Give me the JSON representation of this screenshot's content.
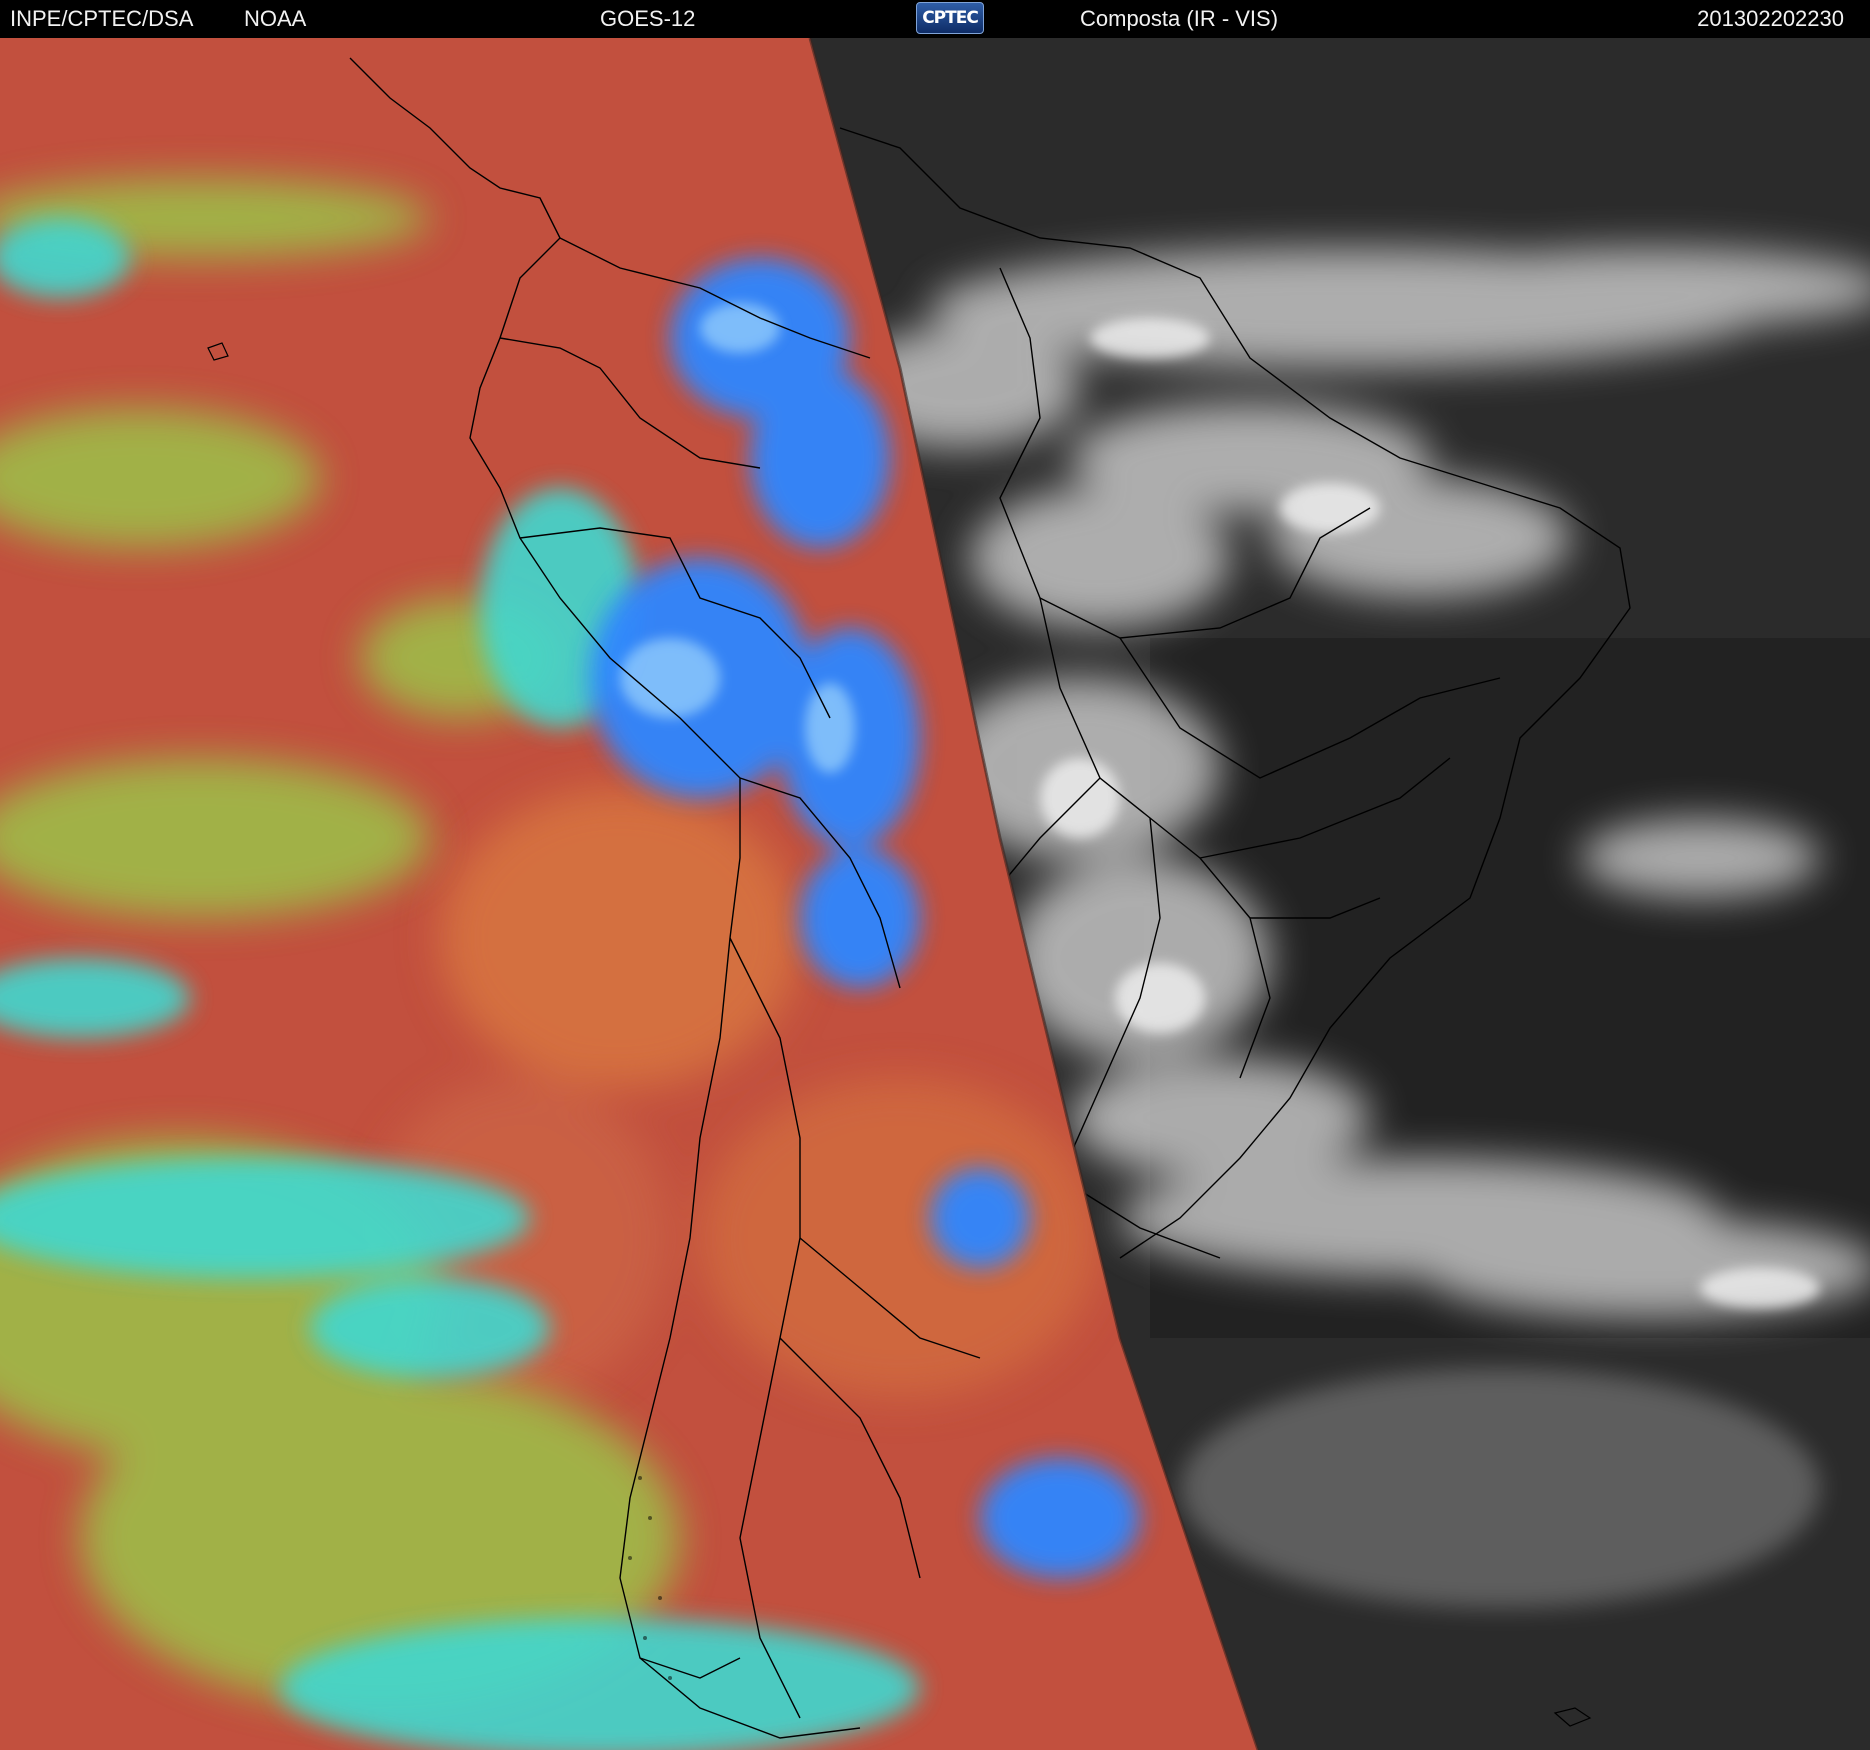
{
  "header": {
    "organization": "INPE/CPTEC/DSA",
    "agency": "NOAA",
    "satellite": "GOES-12",
    "logo_text": "CPTEC",
    "product": "Composta (IR - VIS)",
    "timestamp": "201302202230"
  },
  "map": {
    "region": "South America",
    "left_panel": "IR",
    "right_panel": "VIS",
    "colors": {
      "ir_base": "#c2503e",
      "ir_warm": "#d4703f",
      "ir_cloud_low": "#9cc24a",
      "ir_cloud_high": "#3fd8d0",
      "ir_deep": "#2e86ff",
      "vis_base": "#2b2b2b",
      "vis_cloud": "#d9d9d9",
      "border": "#000000"
    }
  }
}
